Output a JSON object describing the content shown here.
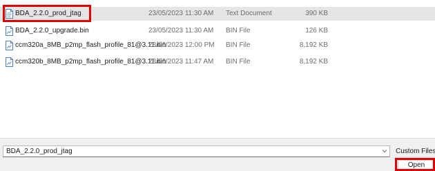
{
  "file_list": {
    "rows": [
      {
        "name": "BDA_2.2.0_prod_jtag",
        "date": "23/05/2023 11:30 AM",
        "type": "Text Document",
        "size": "390 KB",
        "icon": "text-file-icon"
      },
      {
        "name": "BDA_2.2.0_upgrade.bin",
        "date": "23/05/2023 11:30 AM",
        "type": "BIN File",
        "size": "126 KB",
        "icon": "bin-file-icon"
      },
      {
        "name": "ccm320a_8MB_p2mp_flash_profile_81@3.11.bin",
        "date": "28/06/2023 12:00 PM",
        "type": "BIN File",
        "size": "8,192 KB",
        "icon": "bin-file-icon"
      },
      {
        "name": "ccm320b_8MB_p2mp_flash_profile_81@3.11.bin",
        "date": "28/06/2023 11:47 AM",
        "type": "BIN File",
        "size": "8,192 KB",
        "icon": "bin-file-icon"
      }
    ],
    "selected_index": 0
  },
  "footer": {
    "file_name_value": "BDA_2.2.0_prod_jtag",
    "filter_label": "Custom Files",
    "open_label": "Open"
  },
  "colors": {
    "highlight": "#e00000",
    "selection": "#e5e5e5",
    "icon_blue": "#4a7fc1"
  }
}
